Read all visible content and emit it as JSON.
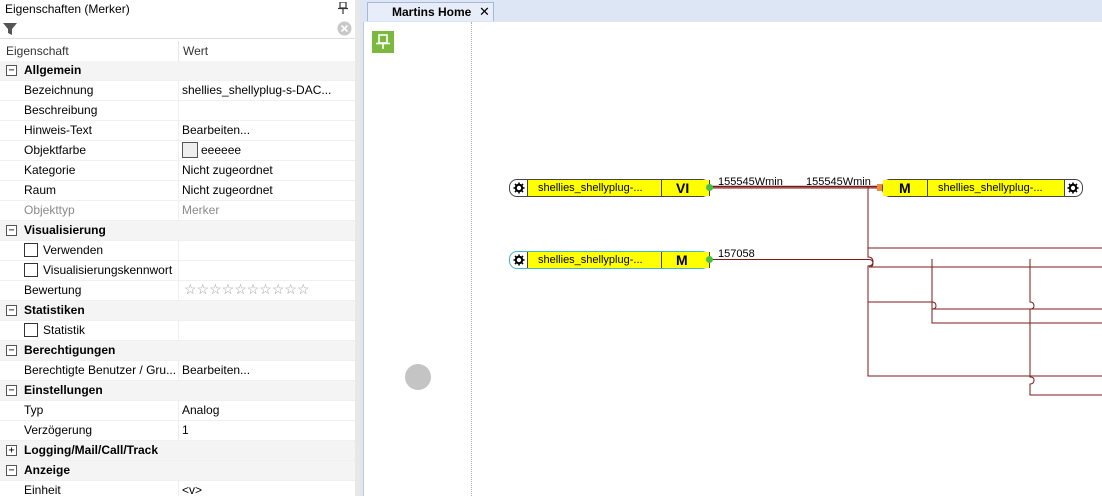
{
  "panel": {
    "title": "Eigenschaften (Merker)",
    "filter_placeholder": "",
    "col_property": "Eigenschaft",
    "col_value": "Wert"
  },
  "rows": {
    "allgemein": "Allgemein",
    "bezeichnung": "Bezeichnung",
    "bezeichnung_val": "shellies_shellyplug-s-DAC...",
    "beschreibung": "Beschreibung",
    "hinweis": "Hinweis-Text",
    "hinweis_val": "Bearbeiten...",
    "objektfarbe": "Objektfarbe",
    "objektfarbe_val": "eeeeee",
    "objektfarbe_color": "#eeeeee",
    "kategorie": "Kategorie",
    "kategorie_val": "Nicht zugeordnet",
    "raum": "Raum",
    "raum_val": "Nicht zugeordnet",
    "objekttyp": "Objekttyp",
    "objekttyp_val": "Merker",
    "visualisierung": "Visualisierung",
    "verwenden": "Verwenden",
    "viskennwort": "Visualisierungskennwort",
    "bewertung": "Bewertung",
    "bewertung_stars": "☆☆☆☆☆☆☆☆☆☆",
    "statistiken": "Statistiken",
    "statistik": "Statistik",
    "berechtigungen": "Berechtigungen",
    "benutzer": "Berechtigte Benutzer / Gru...",
    "benutzer_val": "Bearbeiten...",
    "einstellungen": "Einstellungen",
    "typ": "Typ",
    "typ_val": "Analog",
    "verzoegerung": "Verzögerung",
    "verzoegerung_val": "1",
    "logging": "Logging/Mail/Call/Track",
    "anzeige": "Anzeige",
    "einheit": "Einheit",
    "einheit_val": "<v>"
  },
  "tab": {
    "label": "Martins Home",
    "close": "✕"
  },
  "blocks": {
    "b1_label": "shellies_shellyplug-...",
    "b1_code": "VI",
    "b2_label": "shellies_shellyplug-...",
    "b2_code": "M",
    "b3_label": "shellies_shellyplug-...",
    "b3_code": "M"
  },
  "wire_labels": {
    "w1_out": "155545Wmin",
    "w1_in": "155545Wmin",
    "w2_out": "157058"
  },
  "colors": {
    "block_fill": "#ffff00",
    "wire": "#7b1b1b",
    "pin_button": "#7cb83e",
    "port": "#46c046"
  }
}
